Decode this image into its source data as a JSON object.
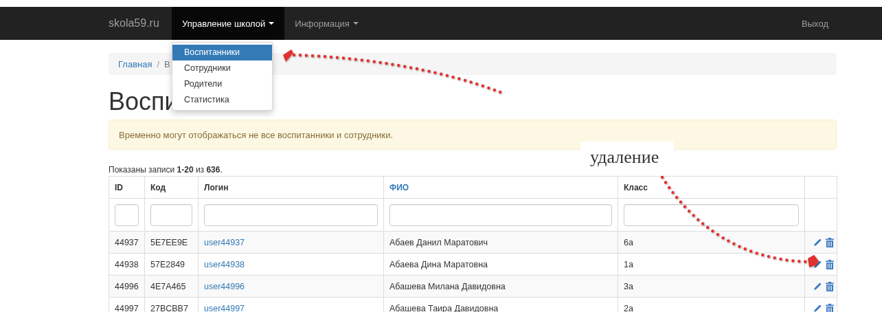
{
  "navbar": {
    "brand": "skola59.ru",
    "menus": [
      {
        "label": "Управление школой",
        "selected": true
      },
      {
        "label": "Информация",
        "selected": false
      }
    ],
    "logout": "Выход"
  },
  "dropdown": {
    "items": [
      {
        "label": "Воспитанники",
        "selected": true
      },
      {
        "label": "Сотрудники",
        "selected": false
      },
      {
        "label": "Родители",
        "selected": false
      },
      {
        "label": "Статистика",
        "selected": false
      }
    ]
  },
  "breadcrumb": {
    "separator": "/",
    "items": [
      "Главная",
      "В"
    ]
  },
  "page_title": "Воспи",
  "alert": "Временно могут отображаться не все воспитанники и сотрудники.",
  "annotation": "удаление",
  "summary": "Показаны записи **1-20** из **636**.",
  "table": {
    "columns": [
      {
        "label": "ID",
        "link": false,
        "filter": true
      },
      {
        "label": "Код",
        "link": false,
        "filter": true
      },
      {
        "label": "Логин",
        "link": false,
        "filter": true
      },
      {
        "label": "ФИО",
        "link": true,
        "filter": true
      },
      {
        "label": "Класс",
        "link": false,
        "filter": true
      },
      {
        "filter": false
      }
    ],
    "rows": [
      {
        "id": "44937",
        "code": "5E7EE9E",
        "login": "user44937",
        "name": "Абаев Данил Маратович",
        "class": "6а"
      },
      {
        "id": "44938",
        "code": "57E2849",
        "login": "user44938",
        "name": "Абаева Дина Маратовна",
        "class": "1а"
      },
      {
        "id": "44996",
        "code": "4E7A465",
        "login": "user44996",
        "name": "Абашева Милана Давидовна",
        "class": "3а"
      },
      {
        "id": "44997",
        "code": "27BCBB7",
        "login": "user44997",
        "name": "Абашева Таира Давидовна",
        "class": "2а"
      }
    ]
  }
}
